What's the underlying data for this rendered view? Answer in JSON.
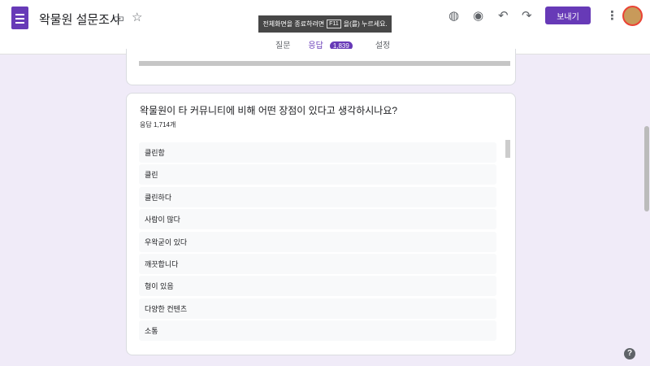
{
  "header": {
    "title": "왁물원 설문조사",
    "send_label": "보내기"
  },
  "toast": {
    "before": "전체화면을 종료하려면",
    "key": "F11",
    "after": "을(를) 누르세요."
  },
  "tabs": [
    {
      "label": "질문"
    },
    {
      "label": "응답",
      "badge": "1,839"
    },
    {
      "label": "설정"
    }
  ],
  "question": {
    "title": "왁물원이 타 커뮤니티에 비해 어떤 장점이 있다고 생각하시나요?",
    "count": "응답 1,714개",
    "answers": [
      "클린함",
      "클린",
      "클린하다",
      "사람이 많다",
      "우왁굳이 있다",
      "깨끗합니다",
      "형이 있음",
      "다양한 컨텐츠",
      "소통"
    ]
  },
  "help": "?"
}
